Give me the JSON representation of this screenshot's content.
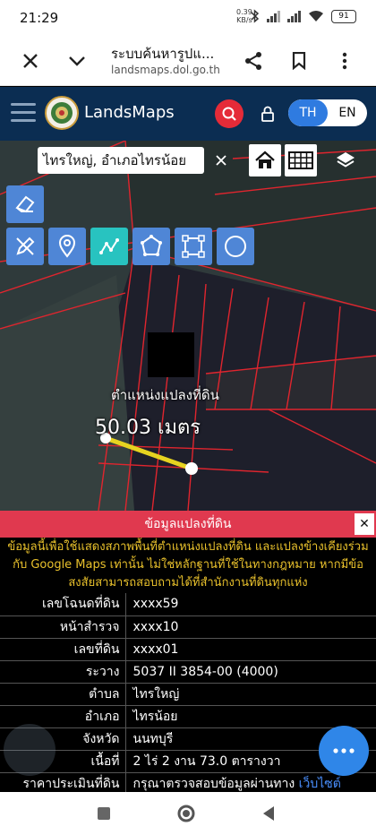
{
  "status_bar": {
    "time": "21:29",
    "net_speed_value": "0.39",
    "net_speed_unit": "KB/s",
    "battery": "91"
  },
  "browser": {
    "title": "ระบบค้นหารูปแ...",
    "url": "landsmaps.dol.go.th"
  },
  "header": {
    "app_name": "LandsMaps",
    "lang_th": "TH",
    "lang_en": "EN",
    "active_lang": "TH"
  },
  "map": {
    "place_text": "ไทรใหญ่, อำเภอไทรน้อย",
    "parcel_label": "ตำแหน่งแปลงที่ดิน",
    "measure_label": "50.03 เมตร",
    "active_draw_tool": "line-measure"
  },
  "info": {
    "title": "ข้อมูลแปลงที่ดิน",
    "close": "✕",
    "notice": "ข้อมูลนี้เพื่อใช้แสดงสภาพพื้นที่ตำแหน่งแปลงที่ดิน และแปลงข้างเคียงร่วมกับ Google Maps เท่านั้น ไม่ใช่หลักฐานที่ใช้ในทางกฎหมาย หากมีข้อสงสัยสามารถสอบถามได้ที่สำนักงานที่ดินทุกแห่ง",
    "rows": [
      {
        "label": "เลขโฉนดที่ดิน",
        "value": "xxxx59"
      },
      {
        "label": "หน้าสำรวจ",
        "value": "xxxx10"
      },
      {
        "label": "เลขที่ดิน",
        "value": "xxxx01"
      },
      {
        "label": "ระวาง",
        "value": "5037 II 3854-00 (4000)"
      },
      {
        "label": "ตำบล",
        "value": "ไทรใหญ่"
      },
      {
        "label": "อำเภอ",
        "value": "ไทรน้อย"
      },
      {
        "label": "จังหวัด",
        "value": "นนทบุรี"
      },
      {
        "label": "เนื้อที่",
        "value": "2 ไร่ 2 งาน 73.0 ตารางวา"
      }
    ],
    "price_label": "ราคาประเมินที่ดิน",
    "price_value": "กรุณาตรวจสอบข้อมูลผ่านทาง",
    "price_link": "เว็บไซต์"
  },
  "colors": {
    "header_bg": "#0b2d52",
    "accent_red": "#e0394f",
    "search_red": "#e52b38",
    "tool_blue": "#4f86d6",
    "tool_active": "#28c3c0",
    "fab_blue": "#2f86e8",
    "notice_yellow": "#e9c12c"
  }
}
